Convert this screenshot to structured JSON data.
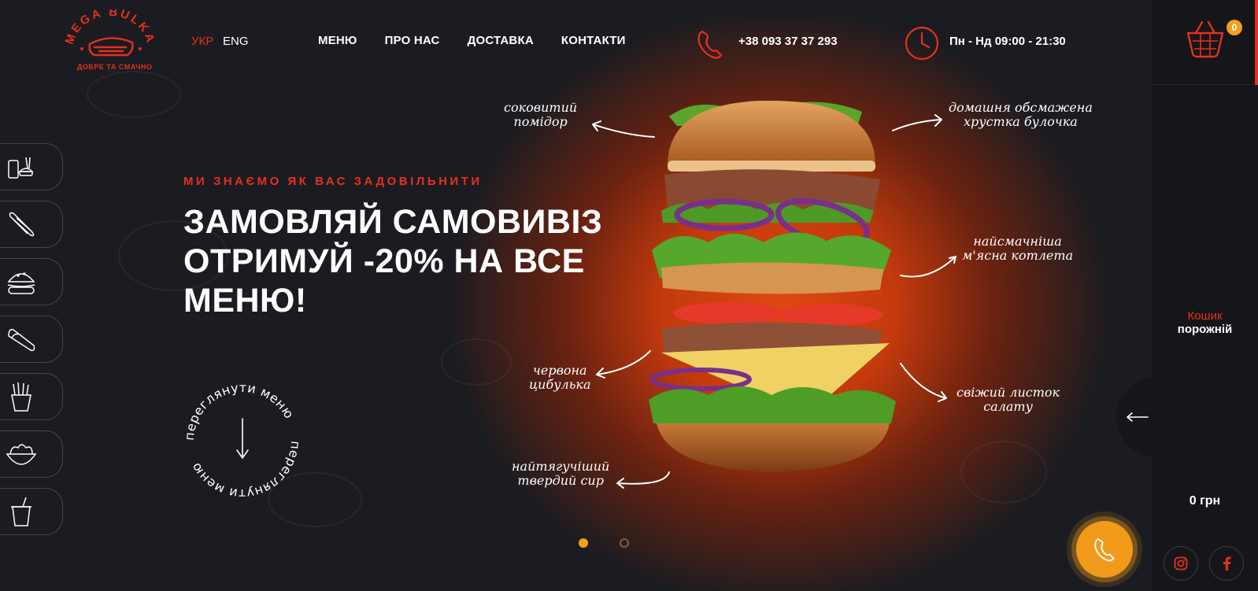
{
  "brand": {
    "name": "MEGA BULKA",
    "tagline": "ДОБРЕ ТА СМАЧНО"
  },
  "languages": [
    {
      "label": "УКР",
      "active": true
    },
    {
      "label": "ENG",
      "active": false
    }
  ],
  "nav": [
    "МЕНЮ",
    "ПРО НАС",
    "ДОСТАВКА",
    "КОНТАКТИ"
  ],
  "contact": {
    "phone": "+38 093 37 37 293",
    "hours": "Пн - Нд 09:00 - 21:30"
  },
  "categories": [
    "combo-icon",
    "hotdog-icon",
    "burger-icon",
    "shawarma-icon",
    "fries-icon",
    "salad-icon",
    "drink-icon"
  ],
  "hero": {
    "kicker": "МИ ЗНАЄМО ЯК ВАС ЗАДОВІЛЬНИТИ",
    "title": "ЗАМОВЛЯЙ САМОВИВІЗ ОТРИМУЙ -20% НА ВСЕ МЕНЮ!",
    "view_menu": "переглянути меню"
  },
  "burger_notes": {
    "tomato": [
      "соковитий",
      "помідор"
    ],
    "bun": [
      "домашня обсмажена",
      "хрустка булочка"
    ],
    "patty": [
      "найсмачніша",
      "м'ясна котлета"
    ],
    "onion": [
      "червона",
      "цибулька"
    ],
    "lettuce": [
      "свіжий листок",
      "салату"
    ],
    "cheese": [
      "найтягучіший",
      "твердий сир"
    ]
  },
  "slider": {
    "total": 2,
    "active": 1
  },
  "cart": {
    "count": "0",
    "title": "Кошик",
    "status": "порожній",
    "total": "0 грн"
  },
  "colors": {
    "accent": "#e5301d",
    "orange": "#f0a020",
    "bg": "#1b1c21",
    "panel": "#15161a"
  }
}
